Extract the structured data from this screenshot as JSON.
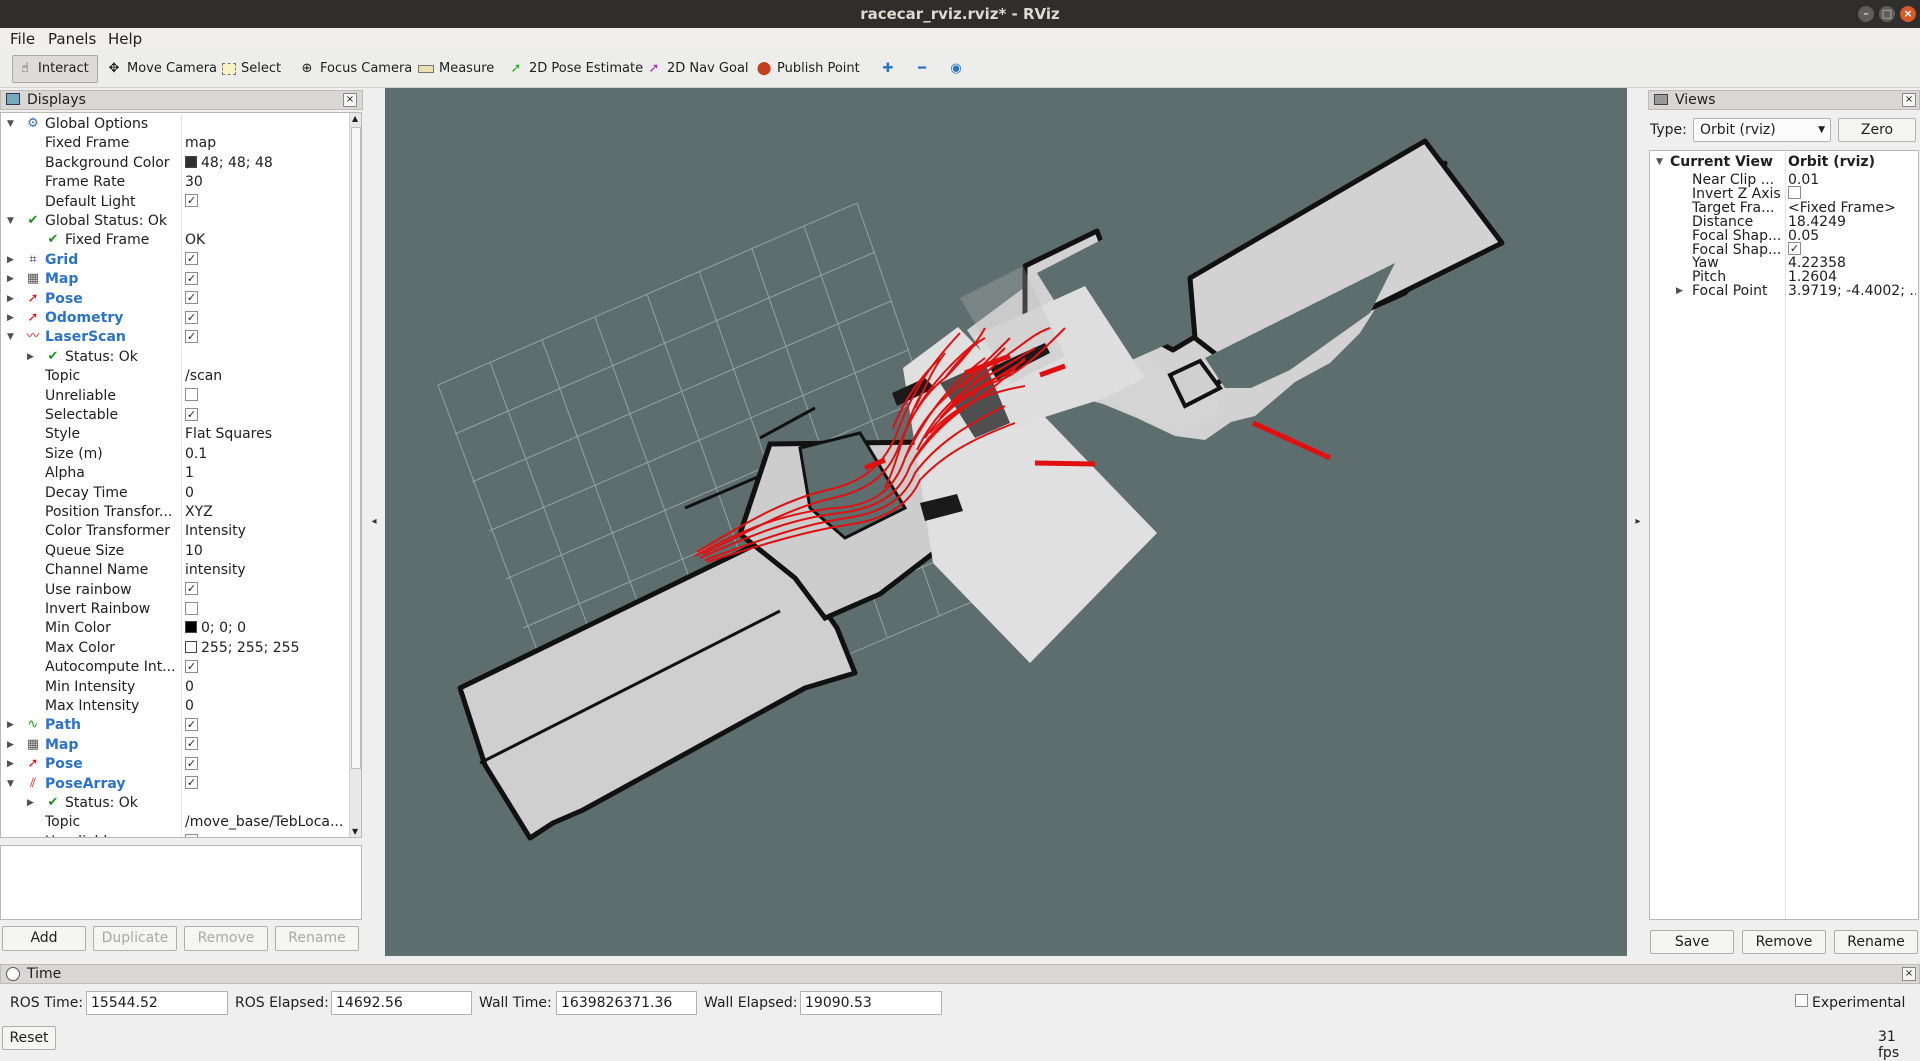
{
  "window": {
    "title": "racecar_rviz.rviz* - RViz"
  },
  "menu": [
    "File",
    "Panels",
    "Help"
  ],
  "toolbar": {
    "interact": "Interact",
    "move_camera": "Move Camera",
    "select": "Select",
    "focus_camera": "Focus Camera",
    "measure": "Measure",
    "pose_estimate": "2D Pose Estimate",
    "nav_goal": "2D Nav Goal",
    "publish_point": "Publish Point"
  },
  "displays": {
    "title": "Displays",
    "buttons": {
      "add": "Add",
      "duplicate": "Duplicate",
      "remove": "Remove",
      "rename": "Rename"
    },
    "rows": [
      {
        "label": "Global Options",
        "value": "",
        "indent": 0,
        "expand": "down",
        "icon": "gear"
      },
      {
        "label": "Fixed Frame",
        "value": "map",
        "indent": 1
      },
      {
        "label": "Background Color",
        "value": "48; 48; 48",
        "indent": 1,
        "swatch": "#303030"
      },
      {
        "label": "Frame Rate",
        "value": "30",
        "indent": 1
      },
      {
        "label": "Default Light",
        "value": "",
        "indent": 1,
        "check": true
      },
      {
        "label": "Global Status: Ok",
        "value": "",
        "indent": 0,
        "expand": "down",
        "icon": "ok"
      },
      {
        "label": "Fixed Frame",
        "value": "OK",
        "indent": 1,
        "icon": "ok"
      },
      {
        "label": "Grid",
        "value": "",
        "indent": 0,
        "expand": "right",
        "icon": "grid",
        "bold": true,
        "check": true
      },
      {
        "label": "Map",
        "value": "",
        "indent": 0,
        "expand": "right",
        "icon": "map",
        "bold": true,
        "check": true
      },
      {
        "label": "Pose",
        "value": "",
        "indent": 0,
        "expand": "right",
        "icon": "pose",
        "bold": true,
        "check": true
      },
      {
        "label": "Odometry",
        "value": "",
        "indent": 0,
        "expand": "right",
        "icon": "odom",
        "bold": true,
        "check": true
      },
      {
        "label": "LaserScan",
        "value": "",
        "indent": 0,
        "expand": "down",
        "icon": "laser",
        "bold": true,
        "check": true
      },
      {
        "label": "Status: Ok",
        "value": "",
        "indent": 1,
        "expand": "right",
        "icon": "ok"
      },
      {
        "label": "Topic",
        "value": "/scan",
        "indent": 1
      },
      {
        "label": "Unreliable",
        "value": "",
        "indent": 1,
        "check": false
      },
      {
        "label": "Selectable",
        "value": "",
        "indent": 1,
        "check": true
      },
      {
        "label": "Style",
        "value": "Flat Squares",
        "indent": 1
      },
      {
        "label": "Size (m)",
        "value": "0.1",
        "indent": 1
      },
      {
        "label": "Alpha",
        "value": "1",
        "indent": 1
      },
      {
        "label": "Decay Time",
        "value": "0",
        "indent": 1
      },
      {
        "label": "Position Transfor...",
        "value": "XYZ",
        "indent": 1
      },
      {
        "label": "Color Transformer",
        "value": "Intensity",
        "indent": 1
      },
      {
        "label": "Queue Size",
        "value": "10",
        "indent": 1
      },
      {
        "label": "Channel Name",
        "value": "intensity",
        "indent": 1
      },
      {
        "label": "Use rainbow",
        "value": "",
        "indent": 1,
        "check": true
      },
      {
        "label": "Invert Rainbow",
        "value": "",
        "indent": 1,
        "check": false
      },
      {
        "label": "Min Color",
        "value": "0; 0; 0",
        "indent": 1,
        "swatch": "#000000"
      },
      {
        "label": "Max Color",
        "value": "255; 255; 255",
        "indent": 1,
        "swatch": "#ffffff"
      },
      {
        "label": "Autocompute Int...",
        "value": "",
        "indent": 1,
        "check": true
      },
      {
        "label": "Min Intensity",
        "value": "0",
        "indent": 1
      },
      {
        "label": "Max Intensity",
        "value": "0",
        "indent": 1
      },
      {
        "label": "Path",
        "value": "",
        "indent": 0,
        "expand": "right",
        "icon": "path",
        "bold": true,
        "check": true
      },
      {
        "label": "Map",
        "value": "",
        "indent": 0,
        "expand": "right",
        "icon": "map",
        "bold": true,
        "check": true
      },
      {
        "label": "Pose",
        "value": "",
        "indent": 0,
        "expand": "right",
        "icon": "pose",
        "bold": true,
        "check": true
      },
      {
        "label": "PoseArray",
        "value": "",
        "indent": 0,
        "expand": "down",
        "icon": "posearray",
        "bold": true,
        "check": true
      },
      {
        "label": "Status: Ok",
        "value": "",
        "indent": 1,
        "expand": "right",
        "icon": "ok"
      },
      {
        "label": "Topic",
        "value": "/move_base/TebLoca...",
        "indent": 1
      },
      {
        "label": "Unreliable",
        "value": "",
        "indent": 1,
        "check": false
      }
    ]
  },
  "views": {
    "title": "Views",
    "type_label": "Type:",
    "type_value": "Orbit (rviz)",
    "zero": "Zero",
    "current_view": "Current View",
    "current_view_type": "Orbit (rviz)",
    "rows": [
      {
        "label": "Near Clip ...",
        "value": "0.01"
      },
      {
        "label": "Invert Z Axis",
        "value": "",
        "check": false
      },
      {
        "label": "Target Fra...",
        "value": "<Fixed Frame>"
      },
      {
        "label": "Distance",
        "value": "18.4249"
      },
      {
        "label": "Focal Shap...",
        "value": "0.05"
      },
      {
        "label": "Focal Shap...",
        "value": "",
        "check": true
      },
      {
        "label": "Yaw",
        "value": "4.22358"
      },
      {
        "label": "Pitch",
        "value": "1.2604"
      },
      {
        "label": "Focal Point",
        "value": "3.9719; -4.4002; ...",
        "expand": true
      }
    ],
    "buttons": {
      "save": "Save",
      "remove": "Remove",
      "rename": "Rename"
    }
  },
  "time": {
    "title": "Time",
    "ros_time_label": "ROS Time:",
    "ros_time": "15544.52",
    "ros_elapsed_label": "ROS Elapsed:",
    "ros_elapsed": "14692.56",
    "wall_time_label": "Wall Time:",
    "wall_time": "1639826371.36",
    "wall_elapsed_label": "Wall Elapsed:",
    "wall_elapsed": "19090.53",
    "experimental": "Experimental",
    "reset": "Reset",
    "fps": "31 fps"
  },
  "colors": {
    "viewport_bg": "#5e6e6e",
    "path": "#e01010",
    "accent": "#2a73c8"
  }
}
